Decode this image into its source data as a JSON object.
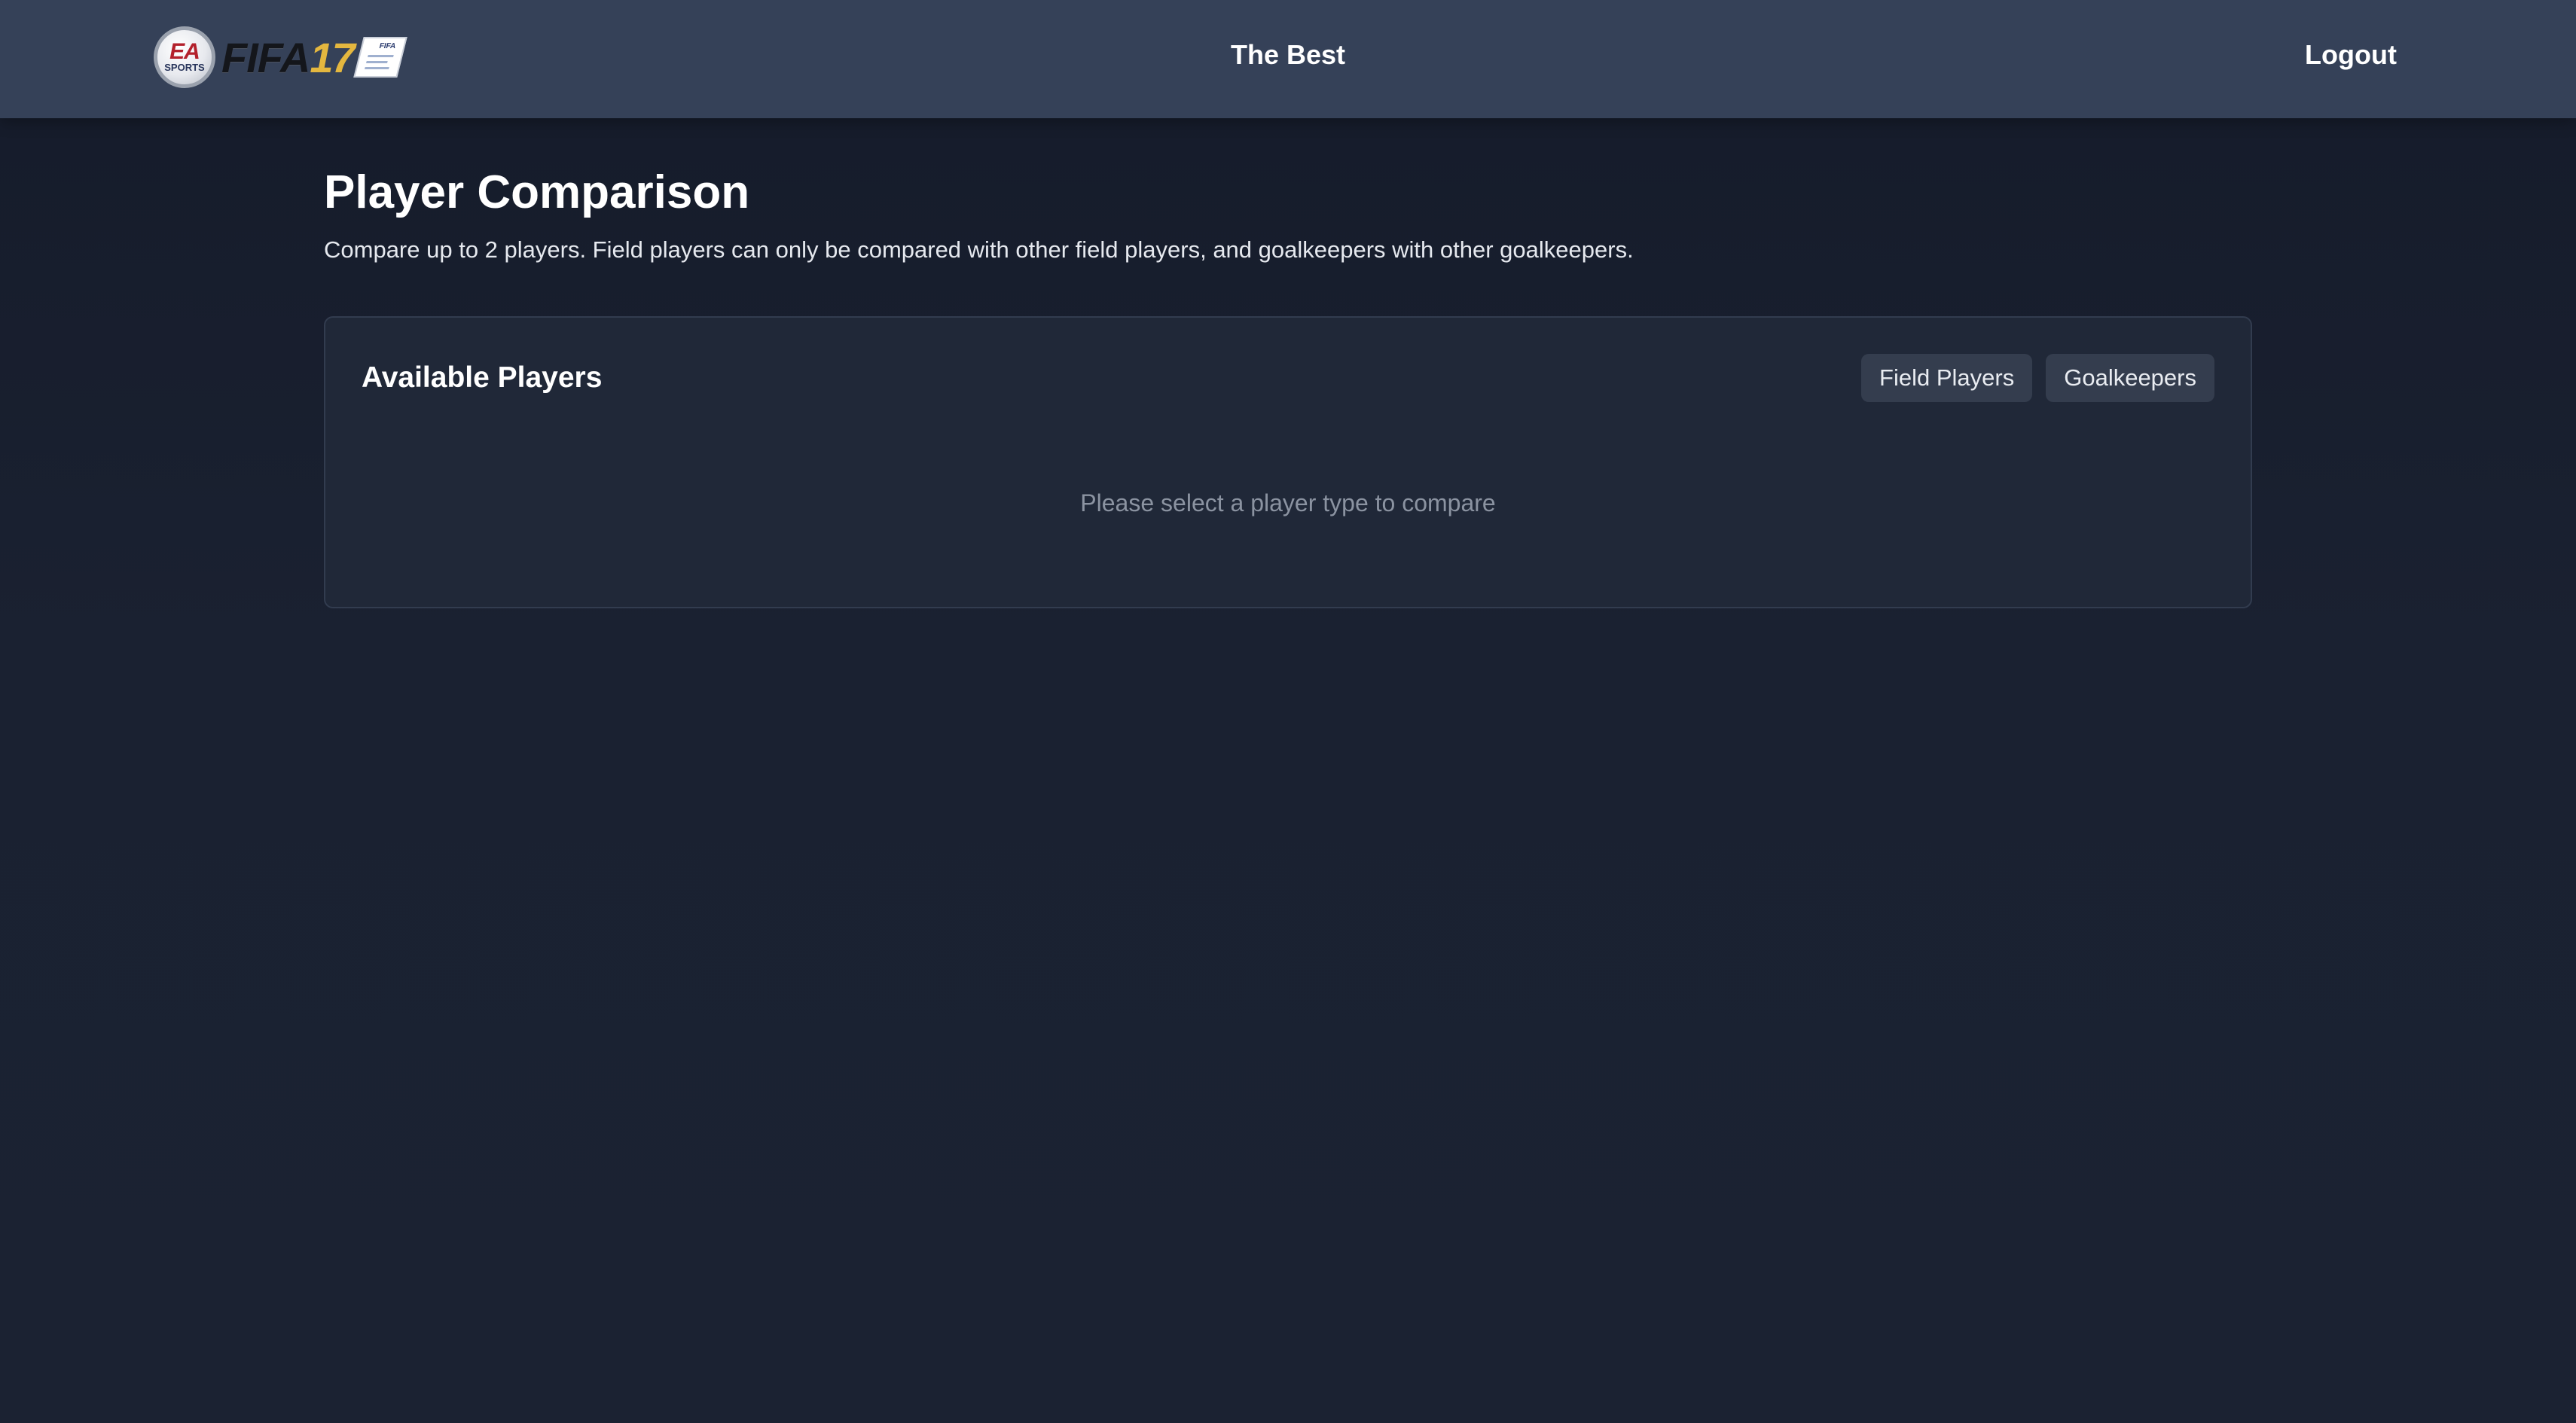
{
  "header": {
    "logo": {
      "badge_top": "EA",
      "badge_bottom": "SPORTS",
      "game_name": "FIFA",
      "game_number": "17",
      "flag_label": "FIFA"
    },
    "center_title": "The Best",
    "logout_label": "Logout"
  },
  "main": {
    "title": "Player Comparison",
    "description": "Compare up to 2 players. Field players can only be compared with other field players, and goalkeepers with other goalkeepers."
  },
  "available_players": {
    "title": "Available Players",
    "filters": [
      "Field Players",
      "Goalkeepers"
    ],
    "empty_message": "Please select a player type to compare"
  },
  "colors": {
    "header_bg": "#354158",
    "page_bg": "#1a2131",
    "card_bg": "#202838",
    "button_bg": "#343d4e",
    "muted_text": "#8b93a1",
    "brand_gold": "#e4b73f",
    "brand_red": "#b3202b"
  }
}
